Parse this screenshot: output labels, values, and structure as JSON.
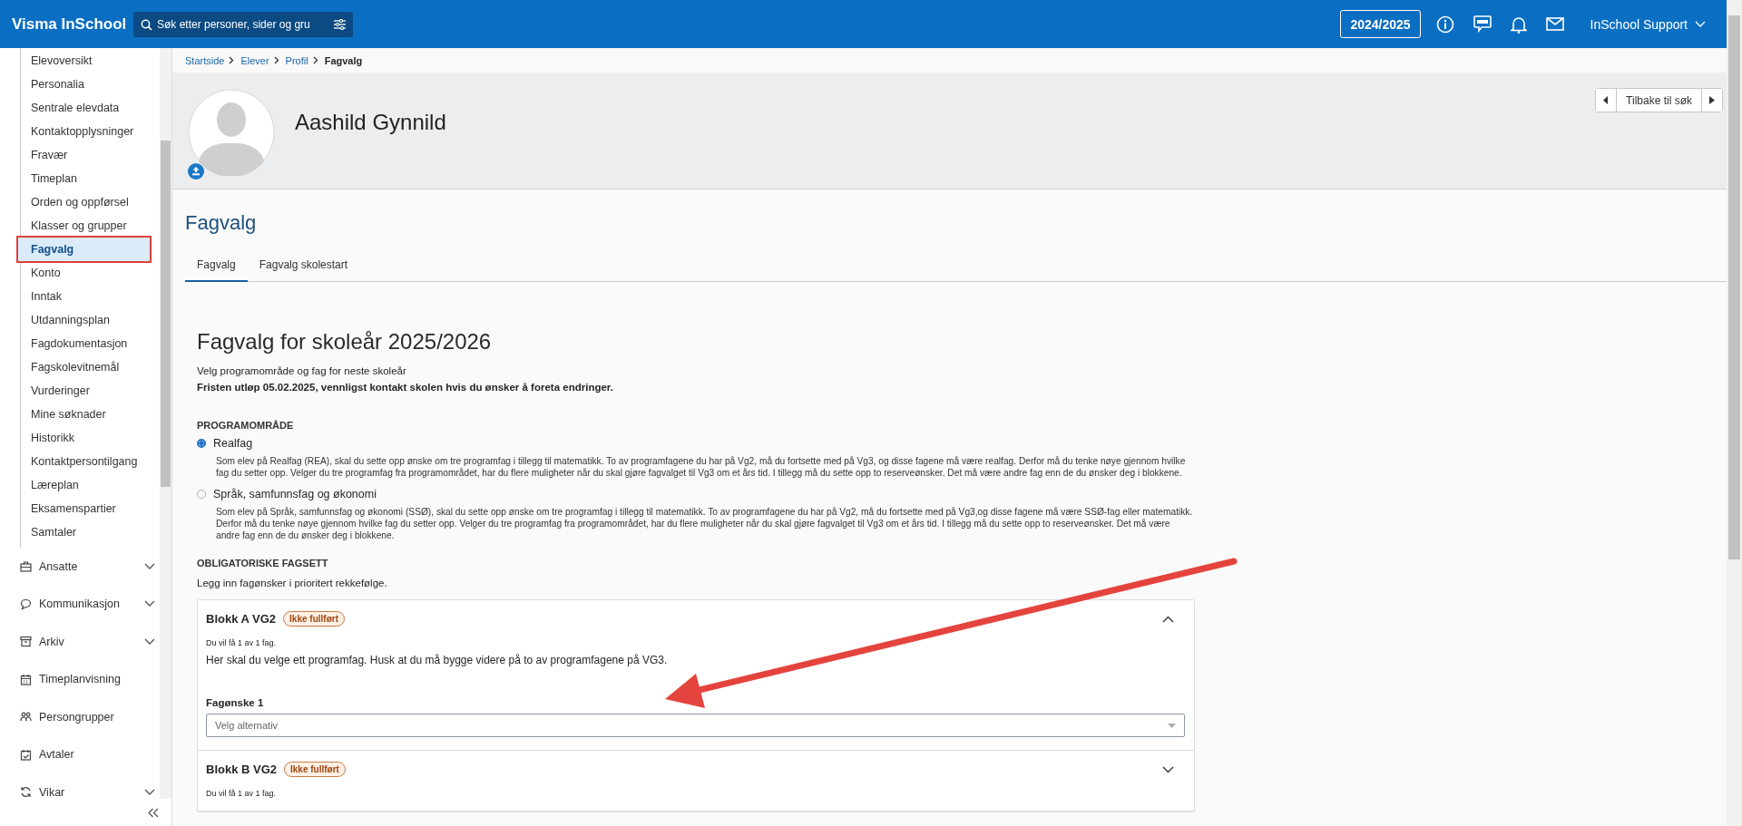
{
  "topbar": {
    "app_name": "Visma InSchool",
    "search": {
      "placeholder": "Søk etter personer, sider og gru"
    },
    "school_year": "2024/2025",
    "user": "InSchool Support"
  },
  "sidebar": {
    "items": [
      {
        "label": "Elevoversikt",
        "selected": false,
        "outlined": false
      },
      {
        "label": "Personalia",
        "selected": false,
        "outlined": false
      },
      {
        "label": "Sentrale elevdata",
        "selected": false,
        "outlined": false
      },
      {
        "label": "Kontaktopplysninger",
        "selected": false,
        "outlined": false
      },
      {
        "label": "Fravær",
        "selected": false,
        "outlined": false
      },
      {
        "label": "Timeplan",
        "selected": false,
        "outlined": false
      },
      {
        "label": "Orden og oppførsel",
        "selected": false,
        "outlined": false
      },
      {
        "label": "Klasser og grupper",
        "selected": false,
        "outlined": false
      },
      {
        "label": "Fagvalg",
        "selected": true,
        "outlined": true
      },
      {
        "label": "Konto",
        "selected": false,
        "outlined": false
      },
      {
        "label": "Inntak",
        "selected": false,
        "outlined": false
      },
      {
        "label": "Utdanningsplan",
        "selected": false,
        "outlined": false
      },
      {
        "label": "Fagdokumentasjon",
        "selected": false,
        "outlined": false
      },
      {
        "label": "Fagskolevitnemål",
        "selected": false,
        "outlined": false
      },
      {
        "label": "Vurderinger",
        "selected": false,
        "outlined": false
      },
      {
        "label": "Mine søknader",
        "selected": false,
        "outlined": false
      },
      {
        "label": "Historikk",
        "selected": false,
        "outlined": false
      },
      {
        "label": "Kontaktpersontilgang",
        "selected": false,
        "outlined": false
      },
      {
        "label": "Læreplan",
        "selected": false,
        "outlined": false
      },
      {
        "label": "Eksamenspartier",
        "selected": false,
        "outlined": false
      },
      {
        "label": "Samtaler",
        "selected": false,
        "outlined": false
      }
    ],
    "sections": [
      {
        "label": "Ansatte",
        "collapsible": true
      },
      {
        "label": "Kommunikasjon",
        "collapsible": true
      },
      {
        "label": "Arkiv",
        "collapsible": true
      },
      {
        "label": "Timeplanvisning",
        "collapsible": false
      },
      {
        "label": "Persongrupper",
        "collapsible": false
      },
      {
        "label": "Avtaler",
        "collapsible": false
      },
      {
        "label": "Vikar",
        "collapsible": true
      }
    ]
  },
  "breadcrumb": [
    {
      "label": "Startside",
      "current": false
    },
    {
      "label": "Elever",
      "current": false
    },
    {
      "label": "Profil",
      "current": false
    },
    {
      "label": "Fagvalg",
      "current": true
    }
  ],
  "profile": {
    "name": "Aashild Gynnild",
    "back_button": "Tilbake til søk"
  },
  "page_title": "Fagvalg",
  "tabs": [
    {
      "label": "Fagvalg",
      "selected": true
    },
    {
      "label": "Fagvalg skolestart",
      "selected": false
    }
  ],
  "form": {
    "heading": "Fagvalg for skoleår 2025/2026",
    "subtitle": "Velg programområde og fag for neste skoleår",
    "deadline": "Fristen utløp 05.02.2025, vennligst kontakt skolen hvis du ønsker å foreta endringer.",
    "program_area": {
      "heading": "PROGRAMOMRÅDE",
      "options": [
        {
          "label": "Realfag",
          "selected": true,
          "description": "Som elev på Realfag (REA), skal du sette opp ønske om tre programfag i tillegg til matematikk. To av programfagene du har på Vg2, må du fortsette med på Vg3, og disse fagene må være realfag. Derfor må du tenke nøye gjennom hvilke fag du setter opp. Velger du tre programfag fra programområdet, har du flere muligheter når du skal gjøre fagvalget til Vg3 om et års tid. I tillegg må du sette opp to reserveønsker. Det må være andre fag enn de du ønsker deg i blokkene."
        },
        {
          "label": "Språk, samfunnsfag og økonomi",
          "selected": false,
          "description": "Som elev på Språk, samfunnsfag og økonomi (SSØ), skal du sette opp ønske om tre programfag i tillegg til matematikk. To av programfagene du har på Vg2, må du fortsette med på Vg3,og disse fagene må være SSØ-fag eller matematikk. Derfor må du tenke nøye gjennom hvilke fag du setter opp. Velger du tre programfag fra programområdet, har du flere muligheter når du skal gjøre fagvalget til Vg3 om et års tid. I tillegg må du sette opp to reserveønsker. Det må være andre fag enn de du ønsker deg i blokkene."
        }
      ]
    },
    "obligatory": {
      "heading": "OBLIGATORISKE FAGSETT",
      "instruction": "Legg inn fagønsker i prioritert rekkefølge.",
      "blocks": [
        {
          "title": "Blokk A VG2",
          "status": "Ikke fullført",
          "expanded": true,
          "info": "Du vil få 1 av 1 fag.",
          "text": "Her skal du velge ett programfag. Husk at du må bygge videre på to av programfagene på VG3.",
          "fields": [
            {
              "label": "Fagønske 1",
              "placeholder": "Velg alternativ"
            }
          ]
        },
        {
          "title": "Blokk B VG2",
          "status": "Ikke fullført",
          "expanded": false,
          "info": "Du vil få 1 av 1 fag."
        }
      ]
    }
  }
}
